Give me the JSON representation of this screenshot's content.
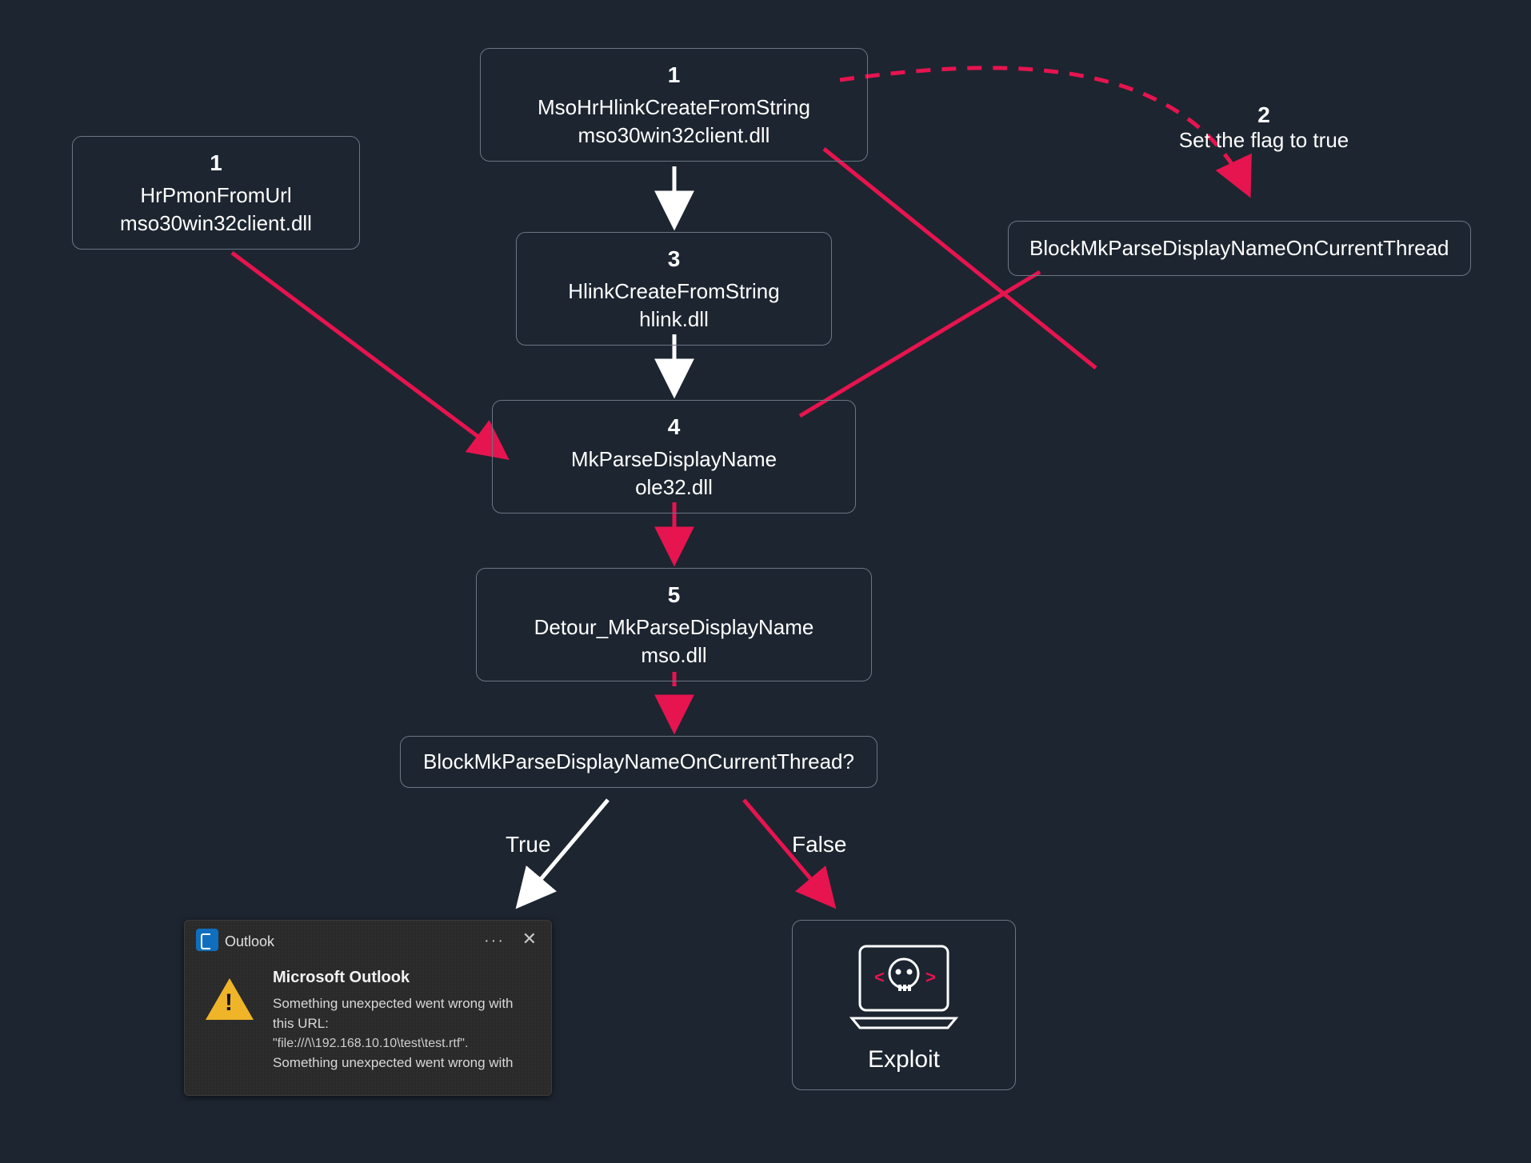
{
  "nodes": {
    "left1": {
      "num": "1",
      "l1": "HrPmonFromUrl",
      "l2": "mso30win32client.dll"
    },
    "n1": {
      "num": "1",
      "l1": "MsoHrHlinkCreateFromString",
      "l2": "mso30win32client.dll"
    },
    "n3": {
      "num": "3",
      "l1": "HlinkCreateFromString",
      "l2": "hlink.dll"
    },
    "n4": {
      "num": "4",
      "l1": "MkParseDisplayName",
      "l2": "ole32.dll"
    },
    "n5": {
      "num": "5",
      "l1": "Detour_MkParseDisplayName",
      "l2": "mso.dll"
    }
  },
  "right": {
    "num": "2",
    "caption": "Set the flag to true",
    "box": "BlockMkParseDisplayNameOnCurrentThread"
  },
  "decision": {
    "text": "BlockMkParseDisplayNameOnCurrentThread?"
  },
  "branches": {
    "true": "True",
    "false": "False"
  },
  "exploit": {
    "label": "Exploit"
  },
  "dlg": {
    "app": "Outlook",
    "heading": "Microsoft Outlook",
    "l1": "Something unexpected went wrong with",
    "l2": "this URL:",
    "path": "\"file:///\\\\192.168.10.10\\test\\test.rtf\".",
    "l3": "Something unexpected went wrong with"
  },
  "colors": {
    "accent": "#e6144f",
    "stroke": "#6a7684",
    "white": "#ffffff",
    "bg": "#1d2530"
  }
}
